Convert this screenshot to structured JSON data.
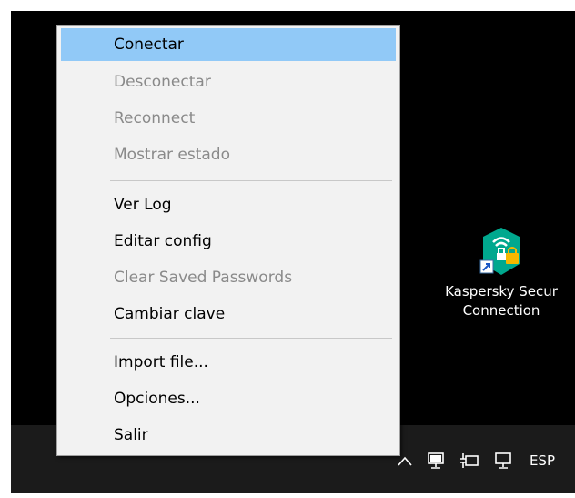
{
  "context_menu": {
    "items": [
      {
        "label": "Conectar",
        "state": "highlighted"
      },
      {
        "label": "Desconectar",
        "state": "disabled"
      },
      {
        "label": "Reconnect",
        "state": "disabled"
      },
      {
        "label": "Mostrar estado",
        "state": "disabled"
      },
      {
        "label": "Ver Log",
        "state": "enabled"
      },
      {
        "label": "Editar config",
        "state": "enabled"
      },
      {
        "label": "Clear Saved Passwords",
        "state": "disabled"
      },
      {
        "label": "Cambiar clave",
        "state": "enabled"
      },
      {
        "label": "Import file...",
        "state": "enabled"
      },
      {
        "label": "Opciones...",
        "state": "enabled"
      },
      {
        "label": "Salir",
        "state": "enabled"
      }
    ]
  },
  "desktop_icon": {
    "label_line1": "Kaspersky Secur",
    "label_line2": "Connection",
    "icon": "kaspersky-vpn-shield-icon"
  },
  "taskbar": {
    "tray_icons": [
      "chevron-up-icon",
      "network-icon",
      "power-plug-icon",
      "network-icon"
    ],
    "language": "ESP"
  },
  "colors": {
    "highlight": "#91c9f7",
    "menu_bg": "#f2f2f2",
    "disabled_text": "#8a8a8a",
    "kaspersky_green": "#00a88e"
  }
}
